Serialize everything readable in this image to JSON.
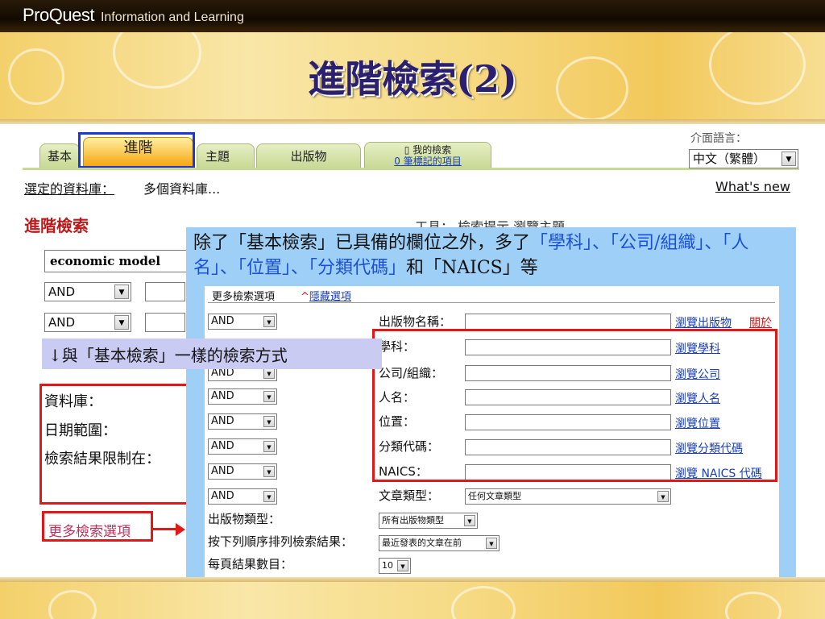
{
  "header": {
    "logo_text": "ProQuest",
    "logo_subtitle": "Information and Learning"
  },
  "slide_title": "進階檢索(2)",
  "tabs": {
    "basic": "基本",
    "advanced": "進階",
    "topic": "主題",
    "publication": "出版物",
    "my_search": "我的檢索",
    "marked_items": "0 筆標記的項目"
  },
  "interface_language": {
    "label": "介面語言：",
    "selected": "中文（繁體）"
  },
  "database_bar": {
    "label": "選定的資料庫：",
    "value": "多個資料庫...",
    "whats_new": "What's new"
  },
  "search_form": {
    "heading": "進階檢索",
    "tools_partial": "工具：  檢索提示   瀏覽主題",
    "query": "economic model",
    "operator1": "AND",
    "operator2": "AND",
    "database_label": "資料庫：",
    "date_range_label": "日期範圍：",
    "limit_label": "檢索結果限制在：",
    "more_options_link": "更多檢索選項"
  },
  "overlay": {
    "text_parts": [
      "除了「基本檢索」已具備的欄位之外，多了",
      "「學科」、「公司/組織」、「人名」、「位置」、「分類代碼」",
      "和「NAICS」等"
    ],
    "same_as_basic": "↓與「基本檢索」一樣的檢索方式"
  },
  "more_options": {
    "title": "更多檢索選項",
    "hide_link": "隱藏選項",
    "rows": [
      {
        "operator": "AND",
        "label": "出版物名稱：",
        "link": "瀏覽出版物",
        "extra": "關於"
      },
      {
        "operator": "",
        "label": "學科：",
        "link": "瀏覽學科"
      },
      {
        "operator": "AND",
        "label": "公司/組織：",
        "link": "瀏覽公司"
      },
      {
        "operator": "AND",
        "label": "人名：",
        "link": "瀏覽人名"
      },
      {
        "operator": "AND",
        "label": "位置：",
        "link": "瀏覽位置"
      },
      {
        "operator": "AND",
        "label": "分類代碼：",
        "link": "瀏覽分類代碼"
      },
      {
        "operator": "AND",
        "label": "NAICS：",
        "link": "瀏覽 NAICS 代碼"
      },
      {
        "operator": "AND",
        "label": "文章類型：",
        "select": "任何文章類型"
      }
    ],
    "pub_type_label": "出版物類型：",
    "pub_type_value": "所有出版物類型",
    "sort_label": "按下列順序排列檢索結果：",
    "sort_value": "最近發表的文章在前",
    "per_page_label": "每頁結果數目：",
    "per_page_value": "10"
  },
  "colors": {
    "title": "#2a1f70",
    "highlight_red": "#e01818",
    "tab_highlight_blue": "#1c39d6",
    "overlay_bg": "#9ed0f7"
  }
}
